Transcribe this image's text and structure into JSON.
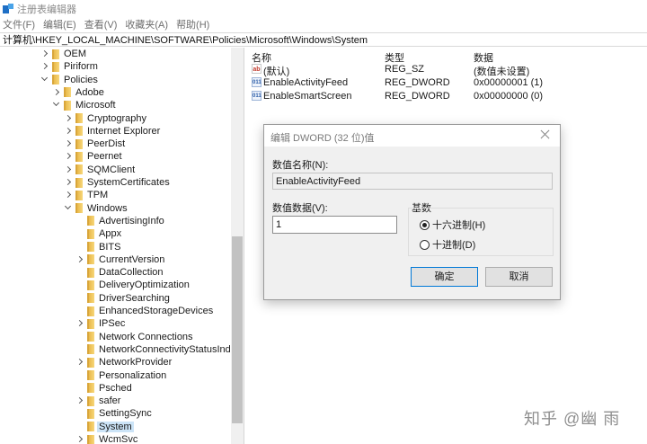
{
  "window": {
    "title": "注册表编辑器"
  },
  "menu": [
    "文件(F)",
    "编辑(E)",
    "查看(V)",
    "收藏夹(A)",
    "帮助(H)"
  ],
  "address": "计算机\\HKEY_LOCAL_MACHINE\\SOFTWARE\\Policies\\Microsoft\\Windows\\System",
  "tree": [
    {
      "label": "OEM",
      "level": 0,
      "state": "collapsed"
    },
    {
      "label": "Piriform",
      "level": 0,
      "state": "collapsed"
    },
    {
      "label": "Policies",
      "level": 0,
      "state": "expanded"
    },
    {
      "label": "Adobe",
      "level": 1,
      "state": "collapsed"
    },
    {
      "label": "Microsoft",
      "level": 1,
      "state": "expanded"
    },
    {
      "label": "Cryptography",
      "level": 2,
      "state": "collapsed"
    },
    {
      "label": "Internet Explorer",
      "level": 2,
      "state": "collapsed"
    },
    {
      "label": "PeerDist",
      "level": 2,
      "state": "collapsed"
    },
    {
      "label": "Peernet",
      "level": 2,
      "state": "collapsed"
    },
    {
      "label": "SQMClient",
      "level": 2,
      "state": "collapsed"
    },
    {
      "label": "SystemCertificates",
      "level": 2,
      "state": "collapsed"
    },
    {
      "label": "TPM",
      "level": 2,
      "state": "collapsed"
    },
    {
      "label": "Windows",
      "level": 2,
      "state": "expanded"
    },
    {
      "label": "AdvertisingInfo",
      "level": 3,
      "state": "leaf"
    },
    {
      "label": "Appx",
      "level": 3,
      "state": "leaf"
    },
    {
      "label": "BITS",
      "level": 3,
      "state": "leaf"
    },
    {
      "label": "CurrentVersion",
      "level": 3,
      "state": "collapsed"
    },
    {
      "label": "DataCollection",
      "level": 3,
      "state": "leaf"
    },
    {
      "label": "DeliveryOptimization",
      "level": 3,
      "state": "leaf"
    },
    {
      "label": "DriverSearching",
      "level": 3,
      "state": "leaf"
    },
    {
      "label": "EnhancedStorageDevices",
      "level": 3,
      "state": "leaf"
    },
    {
      "label": "IPSec",
      "level": 3,
      "state": "collapsed"
    },
    {
      "label": "Network Connections",
      "level": 3,
      "state": "leaf"
    },
    {
      "label": "NetworkConnectivityStatusIndi",
      "level": 3,
      "state": "leaf"
    },
    {
      "label": "NetworkProvider",
      "level": 3,
      "state": "collapsed"
    },
    {
      "label": "Personalization",
      "level": 3,
      "state": "leaf"
    },
    {
      "label": "Psched",
      "level": 3,
      "state": "leaf"
    },
    {
      "label": "safer",
      "level": 3,
      "state": "collapsed"
    },
    {
      "label": "SettingSync",
      "level": 3,
      "state": "leaf"
    },
    {
      "label": "System",
      "level": 3,
      "state": "leaf",
      "selected": true
    },
    {
      "label": "WcmSvc",
      "level": 3,
      "state": "collapsed"
    }
  ],
  "list": {
    "headers": {
      "name": "名称",
      "type": "类型",
      "data": "数据"
    },
    "rows": [
      {
        "icon": "string-value-icon",
        "icon_text": "ab",
        "name": "(默认)",
        "type": "REG_SZ",
        "data": "(数值未设置)"
      },
      {
        "icon": "dword-value-icon",
        "icon_text": "011",
        "name": "EnableActivityFeed",
        "type": "REG_DWORD",
        "data": "0x00000001 (1)"
      },
      {
        "icon": "dword-value-icon",
        "icon_text": "011",
        "name": "EnableSmartScreen",
        "type": "REG_DWORD",
        "data": "0x00000000 (0)"
      }
    ]
  },
  "dialog": {
    "title": "编辑 DWORD (32 位)值",
    "name_label": "数值名称(N):",
    "name_value": "EnableActivityFeed",
    "data_label": "数值数据(V):",
    "data_value": "1",
    "base_label": "基数",
    "radio_hex": "十六进制(H)",
    "radio_dec": "十进制(D)",
    "selected_base": "hex",
    "ok_label": "确定",
    "cancel_label": "取消"
  },
  "watermark": "知乎 @幽 雨"
}
